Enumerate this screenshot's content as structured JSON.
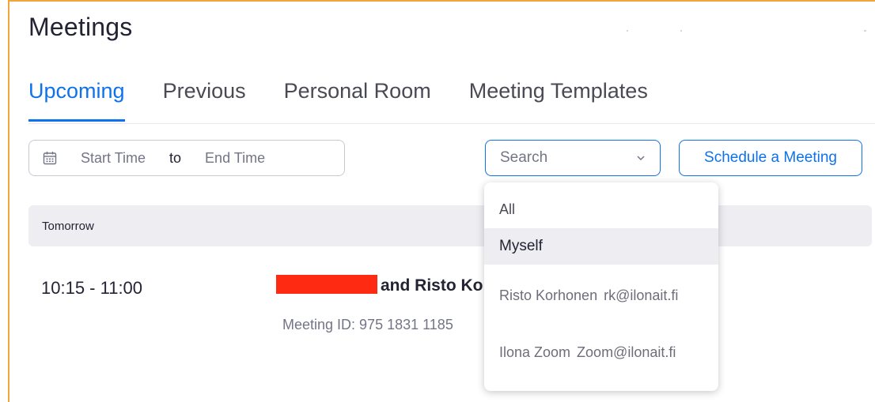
{
  "page": {
    "title": "Meetings"
  },
  "tabs": [
    {
      "label": "Upcoming",
      "active": true
    },
    {
      "label": "Previous",
      "active": false
    },
    {
      "label": "Personal Room",
      "active": false
    },
    {
      "label": "Meeting Templates",
      "active": false
    }
  ],
  "filters": {
    "date_icon": "calendar-icon",
    "start_placeholder": "Start Time",
    "to_label": "to",
    "end_placeholder": "End Time",
    "search_value": "Search",
    "search_icon": "chevron-down-icon"
  },
  "actions": {
    "schedule_label": "Schedule a Meeting"
  },
  "meetings": {
    "group_label": "Tomorrow",
    "items": [
      {
        "time": "10:15 - 11:00",
        "topic": "and Risto Ko",
        "id_label": "Meeting ID:",
        "id_value": "975 1831 1185"
      }
    ]
  },
  "search_dropdown": {
    "options": [
      {
        "label": "All"
      },
      {
        "label": "Myself",
        "highlighted": true
      },
      {
        "name": "Risto Korhonen",
        "email": "rk@ilonait.fi"
      },
      {
        "name": "Ilona Zoom",
        "email": "Zoom@ilonait.fi"
      }
    ]
  },
  "colors": {
    "accent": "#0e72ed",
    "frame": "#f2a53a",
    "redaction": "#ff2a12",
    "header_bg": "#ededf2"
  }
}
